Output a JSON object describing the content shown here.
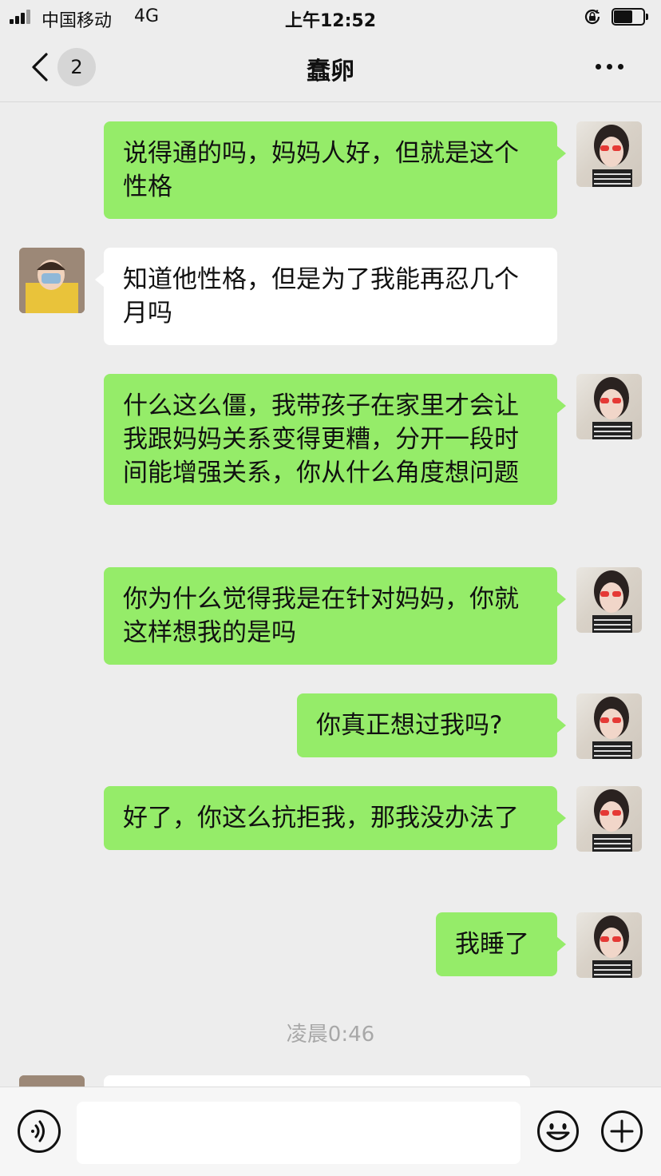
{
  "status_bar": {
    "carrier": "中国移动",
    "network": "4G",
    "time": "上午12:52",
    "battery_level": 0.65
  },
  "nav": {
    "unread_count": "2",
    "title": "蠢卵"
  },
  "messages": [
    {
      "sender": "me",
      "text": "说得通的吗，妈妈人好，但就是这个性格"
    },
    {
      "sender": "other",
      "text": "知道他性格，但是为了我能再忍几个月吗"
    },
    {
      "sender": "me",
      "text": "什么这么僵，我带孩子在家里才会让我跟妈妈关系变得更糟，分开一段时间能增强关系，你从什么角度想问题"
    },
    {
      "sender": "me",
      "text": "你为什么觉得我是在针对妈妈，你就这样想我的是吗"
    },
    {
      "sender": "me",
      "text": "你真正想过我吗?"
    },
    {
      "sender": "me",
      "text": "好了，你这么抗拒我，那我没办法了"
    },
    {
      "sender": "me",
      "text": "我睡了"
    }
  ],
  "timestamp": "凌晨0:46",
  "colors": {
    "my_bubble": "#95ec69",
    "other_bubble": "#ffffff",
    "background": "#ededed"
  },
  "icons": {
    "voice": "voice-icon",
    "emoji": "emoji-icon",
    "plus": "plus-icon",
    "back": "chevron-left-icon",
    "more": "more-icon"
  }
}
